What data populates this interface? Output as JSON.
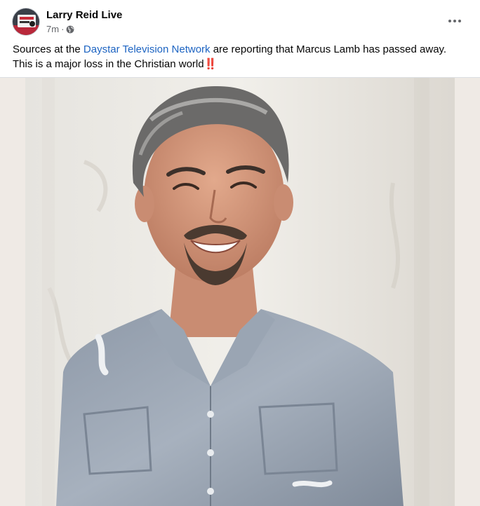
{
  "post": {
    "author_name": "Larry Reid Live",
    "timestamp": "7m",
    "separator": "·",
    "privacy_icon": "globe-icon",
    "more_icon": "more-horizontal-icon",
    "text_before_link": "Sources at the ",
    "link_text": "Daystar Television Network",
    "text_after_link": " are reporting that Marcus Lamb has passed away. This is a major loss in the Christian world",
    "emoji": "‼️"
  },
  "colors": {
    "link": "#1d64c2",
    "meta_text": "#65676b",
    "emoji_red": "#e0242a"
  }
}
